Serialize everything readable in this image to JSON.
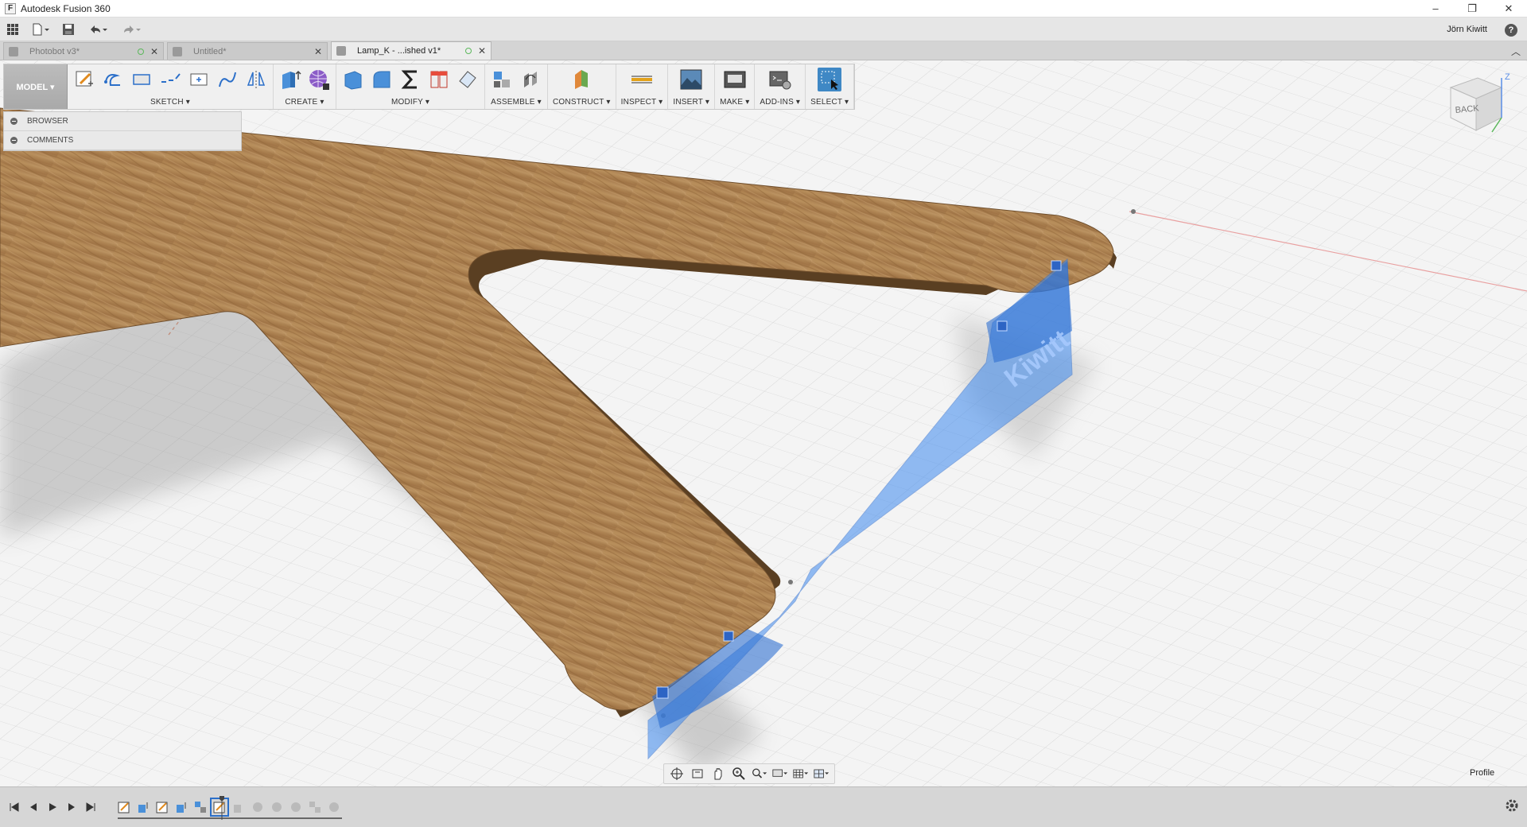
{
  "window": {
    "app_icon": "F",
    "title": "Autodesk Fusion 360",
    "min": "–",
    "restore": "❐",
    "close": "✕"
  },
  "quick_access": {
    "user_name": "Jörn Kiwitt",
    "help_label": "?"
  },
  "doc_tabs": [
    {
      "label": "Photobot v3*",
      "active": false
    },
    {
      "label": "Untitled*",
      "active": false
    },
    {
      "label": "Lamp_K - ...ished v1*",
      "active": true
    }
  ],
  "toolbar": {
    "workspace": "MODEL ▾",
    "groups": [
      {
        "label": "SKETCH ▾",
        "icons": [
          "sketch-create-icon",
          "arc-icon",
          "rectangle-icon",
          "line-icon",
          "point-icon",
          "spline-icon",
          "mirror-icon"
        ]
      },
      {
        "label": "CREATE ▾",
        "icons": [
          "extrude-icon",
          "form-sphere-icon"
        ]
      },
      {
        "label": "MODIFY ▾",
        "icons": [
          "press-pull-icon",
          "fillet-icon",
          "parameters-icon",
          "split-icon",
          "shell-icon"
        ]
      },
      {
        "label": "ASSEMBLE ▾",
        "icons": [
          "new-component-icon",
          "joint-icon"
        ]
      },
      {
        "label": "CONSTRUCT ▾",
        "icons": [
          "plane-icon"
        ]
      },
      {
        "label": "INSPECT ▾",
        "icons": [
          "measure-icon"
        ]
      },
      {
        "label": "INSERT ▾",
        "icons": [
          "insert-image-icon"
        ]
      },
      {
        "label": "MAKE ▾",
        "icons": [
          "make-print-icon"
        ]
      },
      {
        "label": "ADD-INS ▾",
        "icons": [
          "scripts-icon"
        ]
      },
      {
        "label": "SELECT ▾",
        "icons": [
          "select-icon"
        ]
      }
    ]
  },
  "browser_panel": {
    "rows": [
      "BROWSER",
      "COMMENTS"
    ]
  },
  "viewcube": {
    "face": "BACK",
    "axis_z": "Z"
  },
  "scene": {
    "engraved_text": "Kiwitt"
  },
  "status": {
    "selection_filter": "Profile"
  },
  "colors": {
    "wood": "#b48a57",
    "wood_dark": "#8a6338",
    "selection_blue": "#3d8af0",
    "grid": "#d5d5d5",
    "accent": "#3f88c5"
  }
}
